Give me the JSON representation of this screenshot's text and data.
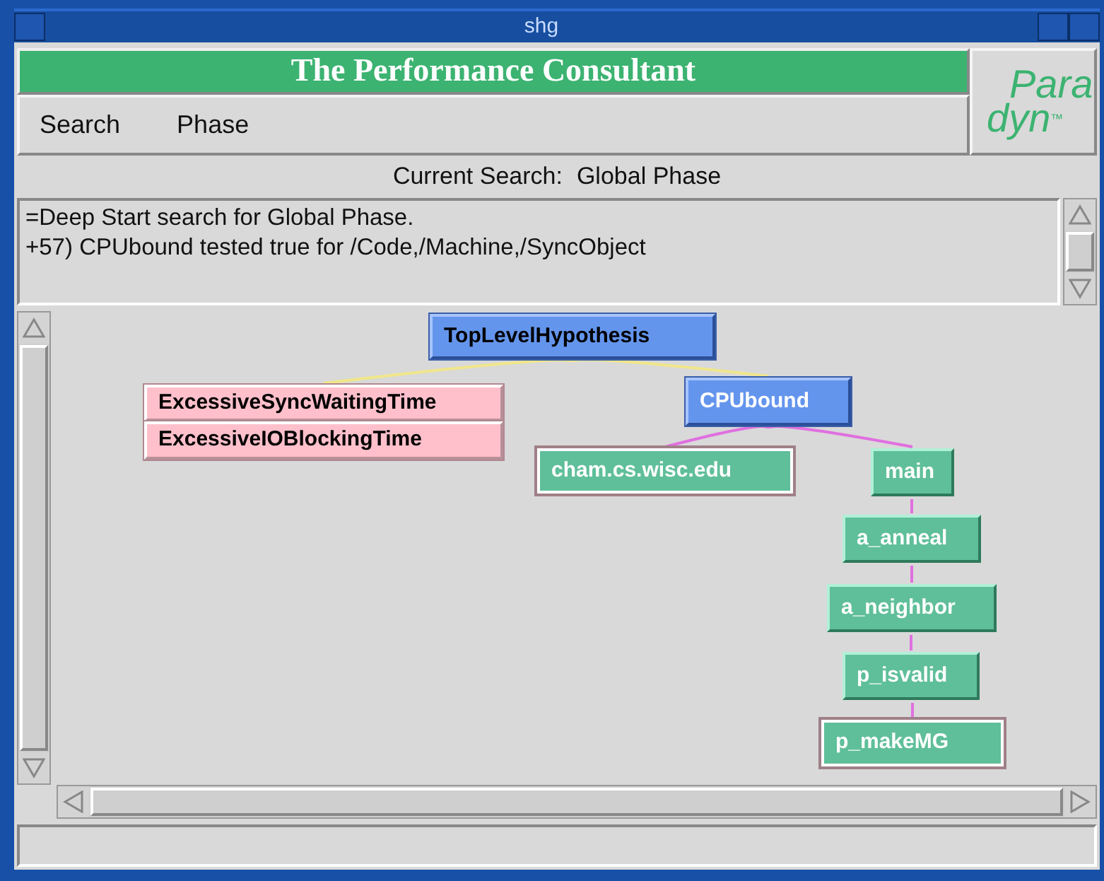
{
  "window": {
    "title": "shg"
  },
  "header": {
    "title": "The Performance Consultant"
  },
  "menu": [
    "Search",
    "Phase"
  ],
  "logo": {
    "line_1": "Para",
    "line_2": "dyn",
    "mark": "™"
  },
  "current_search": {
    "label": "Current Search:",
    "value": "Global Phase"
  },
  "log": [
    "=Deep Start search for Global Phase.",
    "+57) CPUbound tested true for /Code,/Machine,/SyncObject"
  ],
  "graph": {
    "root": {
      "label": "TopLevelHypothesis",
      "kind": "root",
      "children": [
        {
          "label": "ExcessiveSyncWaitingTime",
          "kind": "false"
        },
        {
          "label": "ExcessiveIOBlockingTime",
          "kind": "false"
        },
        {
          "label": "CPUbound",
          "kind": "true",
          "children": [
            {
              "label": "cham.cs.wisc.edu",
              "kind": "pending"
            },
            {
              "label": "main",
              "kind": "testing",
              "children": [
                {
                  "label": "a_anneal",
                  "kind": "testing",
                  "children": [
                    {
                      "label": "a_neighbor",
                      "kind": "testing",
                      "children": [
                        {
                          "label": "p_isvalid",
                          "kind": "testing",
                          "children": [
                            {
                              "label": "p_makeMG",
                              "kind": "pending"
                            }
                          ]
                        }
                      ]
                    }
                  ]
                }
              ]
            }
          ]
        }
      ]
    }
  }
}
